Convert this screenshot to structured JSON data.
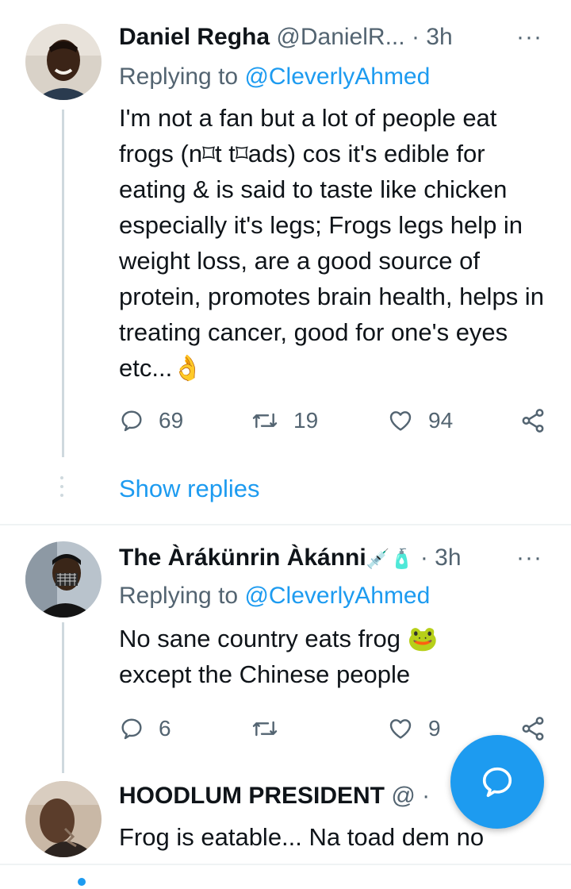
{
  "tweets": [
    {
      "name": "Daniel Regha",
      "handle": "@DanielR...",
      "separator": "·",
      "time": "3h",
      "more": "···",
      "replying_prefix": "Replying to ",
      "replying_to": "@CleverlyAhmed",
      "text": "I'm not a fan but a lot of people eat frogs (n⌑t t⌑ads) cos it's edible for eating & is said to taste like chicken especially it's legs; Frogs legs help in weight loss, are a good source of protein, promotes brain health, helps in treating cancer, good for one's eyes etc...👌",
      "replies": "69",
      "retweets": "19",
      "likes": "94",
      "show_replies": "Show replies"
    },
    {
      "name": "The Àrákünrin Àkánni",
      "name_emoji": "💉🧴",
      "separator": "·",
      "time": "3h",
      "more": "···",
      "replying_prefix": "Replying to ",
      "replying_to": "@CleverlyAhmed",
      "text": "No sane country eats frog 🐸 except the Chinese people",
      "replies": "6",
      "retweets": "",
      "likes": "9"
    },
    {
      "name": "HOODLUM PRESIDENT",
      "handle": "@",
      "separator": "·",
      "text": "Frog is eatable... Na toad dem no"
    }
  ],
  "colors": {
    "accent": "#1d9bf0",
    "text": "#0f1419",
    "muted": "#536471",
    "line": "#cfd9de"
  },
  "icons": [
    "reply-icon",
    "retweet-icon",
    "like-icon",
    "share-icon",
    "compose-reply-icon",
    "more-icon"
  ]
}
